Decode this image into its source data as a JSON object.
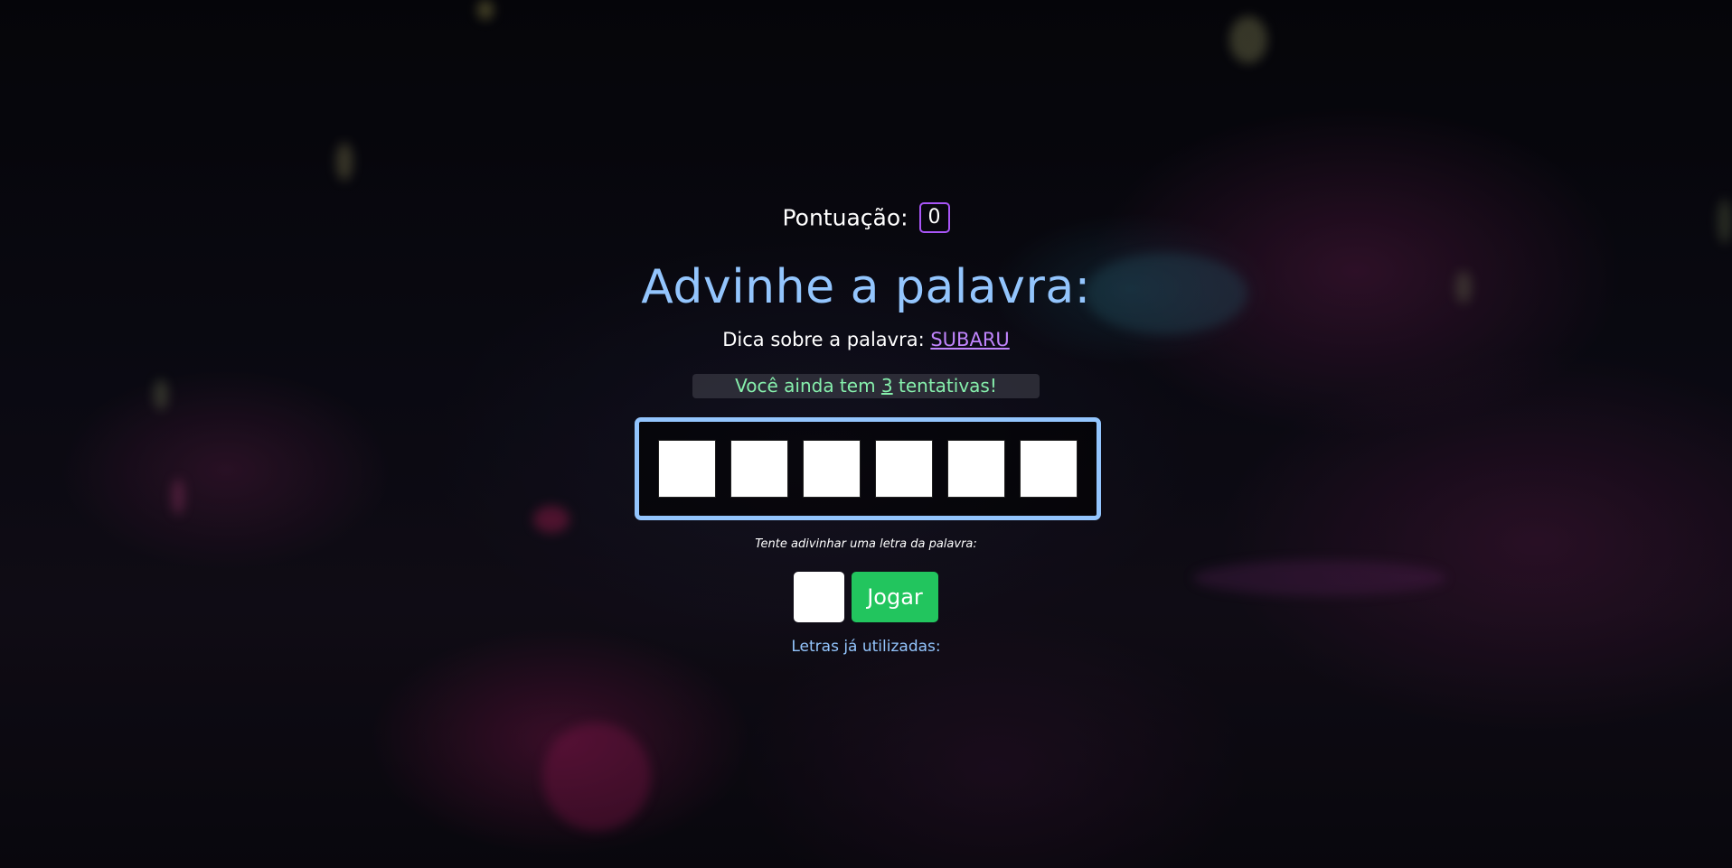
{
  "score": {
    "label": "Pontuação:",
    "value": "0"
  },
  "title": "Advinhe a palavra:",
  "hint": {
    "label": "Dica sobre a palavra:",
    "word": "SUBARU"
  },
  "attempts": {
    "prefix": "Você ainda tem",
    "count": "3",
    "suffix": "tentativas!"
  },
  "word": {
    "letters": [
      "",
      "",
      "",
      "",
      "",
      ""
    ]
  },
  "instruction": "Tente adivinhar uma letra da palavra:",
  "input": {
    "value": ""
  },
  "play_button": "Jogar",
  "used_letters": {
    "label": "Letras já utilizadas:",
    "letters": ""
  },
  "colors": {
    "title": "#93c5fd",
    "hint_word": "#c084fc",
    "attempts_text": "#86efac",
    "play_button": "#22c55e",
    "score_border": "#a855f7"
  }
}
